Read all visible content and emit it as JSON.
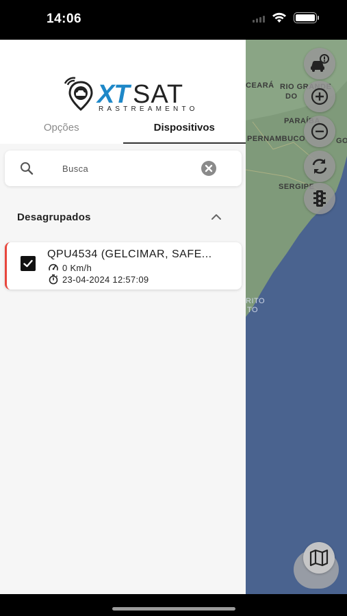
{
  "status_bar": {
    "time": "14:06"
  },
  "logo": {
    "brand_xt": "XT",
    "brand_sat": "SAT",
    "subtitle": "RASTREAMENTO"
  },
  "tabs": [
    {
      "label": "Opções",
      "active": false
    },
    {
      "label": "Dispositivos",
      "active": true
    }
  ],
  "search": {
    "placeholder": "Busca",
    "value": ""
  },
  "group": {
    "title": "Desagrupados",
    "expanded": true
  },
  "devices": [
    {
      "name": "QPU4534 (GELCIMAR, SAFE...",
      "speed": "0 Km/h",
      "timestamp": "23-04-2024 12:57:09",
      "checked": true,
      "status_color": "#e8453c"
    }
  ],
  "map": {
    "labels": [
      "CEARÁ",
      "RIO GRANDE",
      "DO",
      "PARAÍBA",
      "PERNAMBUCO",
      "SERGIPE",
      "RITO",
      "TO",
      "GO"
    ],
    "buttons": [
      "car-alert-icon",
      "zoom-in-icon",
      "zoom-out-icon",
      "refresh-icon",
      "traffic-light-icon",
      "map-icon"
    ]
  },
  "colors": {
    "brand_blue": "#1e88c8",
    "alert_red": "#e8453c",
    "ocean": "#4a638f"
  }
}
